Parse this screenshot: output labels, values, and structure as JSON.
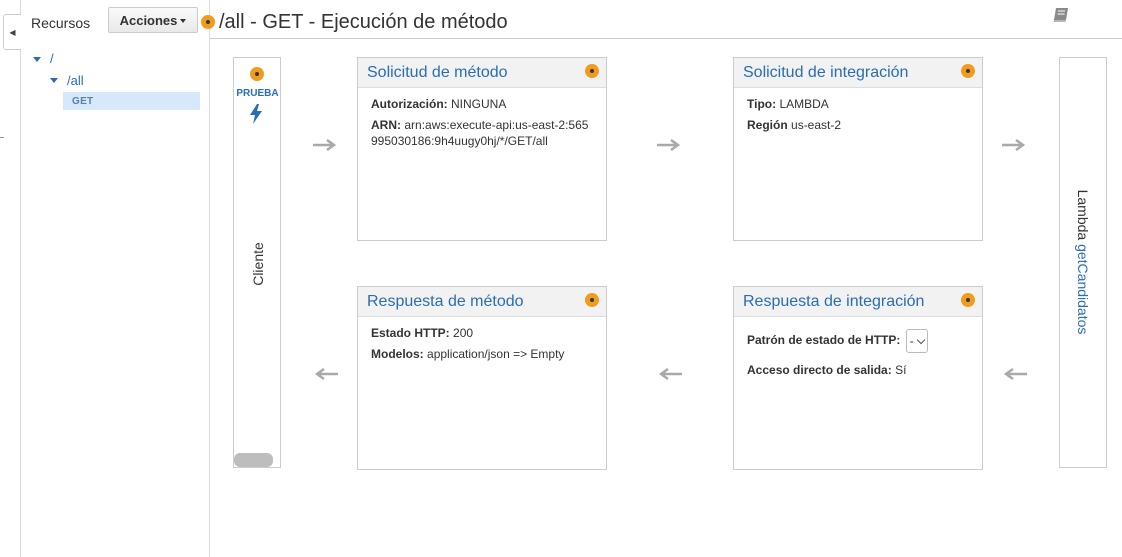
{
  "sidebar": {
    "title": "Recursos",
    "actions_label": "Acciones",
    "tree": {
      "root": "/",
      "child": "/all",
      "method": "GET"
    }
  },
  "header": {
    "title": "/all - GET - Ejecución de método"
  },
  "client": {
    "test_label": "PRUEBA",
    "label": "Cliente"
  },
  "method_request": {
    "title": "Solicitud de método",
    "auth_label": "Autorización:",
    "auth_value": "NINGUNA",
    "arn_label": "ARN:",
    "arn_value": "arn:aws:execute-api:us-east-2:565995030186:9h4uugy0hj/*/GET/all"
  },
  "integration_request": {
    "title": "Solicitud de integración",
    "type_label": "Tipo:",
    "type_value": "LAMBDA",
    "region_label": "Región",
    "region_value": "us-east-2"
  },
  "method_response": {
    "title": "Respuesta de método",
    "status_label": "Estado HTTP:",
    "status_value": "200",
    "models_label": "Modelos:",
    "models_value": "application/json => Empty"
  },
  "integration_response": {
    "title": "Respuesta de integración",
    "pattern_label": "Patrón de estado de HTTP:",
    "pattern_value": "-",
    "passthrough_label": "Acceso directo de salida:",
    "passthrough_value": "Sí"
  },
  "lambda": {
    "prefix": "Lambda",
    "function_name": "getCandidatos"
  },
  "colors": {
    "accent_blue": "#2a6db5",
    "marker_orange": "#f29b1d",
    "arrow_gray": "#a9a9a9"
  },
  "icons": [
    "collapse-left-icon",
    "book-icon",
    "bolt-icon",
    "arrow-right-icon",
    "arrow-left-icon",
    "chevron-down-icon",
    "tree-expand-icon"
  ]
}
